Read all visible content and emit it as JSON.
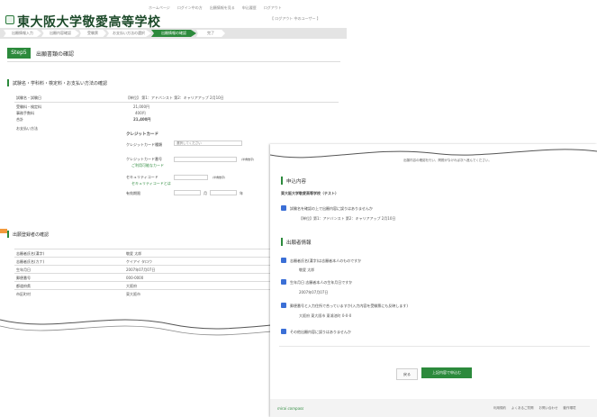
{
  "back": {
    "school_name": "東大阪大学敬愛高等学校",
    "top_links": [
      "ホームページ",
      "ログイン中の方",
      "出願情報を見る",
      "申込履歴",
      "ログアウト"
    ],
    "user": "【 ログアウト 中のユーザー 】",
    "steps": [
      "出願情報入力",
      "出願内容確認",
      "受験票",
      "お支払い方法の選択",
      "出願情報の確認",
      "完了"
    ],
    "step_badge": "Step5",
    "page_heading": "出願書類の確認",
    "section1_title": "試験名・学科料・検定料・お支払い方法の確認",
    "row_header": {
      "label": "試験名・試験日",
      "value": "【単位】 第1：アドバンスト 第2：キャリアアップ 2月10日"
    },
    "fee_rows": [
      {
        "label": "受験料・検定料",
        "value": "21,000円"
      },
      {
        "label": "事務手数料",
        "value": "400円"
      },
      {
        "label": "合計",
        "value": "21,400円"
      }
    ],
    "payment_label": "お支払い方法",
    "card_heading": "クレジットカード",
    "card_fields": [
      {
        "label": "クレジットカード種類",
        "value": "選択してください"
      },
      {
        "label": "クレジットカード番号",
        "value": ""
      },
      {
        "label": "セキュリティコード",
        "value": ""
      },
      {
        "label": "有効期限",
        "value": ""
      }
    ],
    "card_links": [
      "ご利用可能なカード",
      "セキュリティコードとは"
    ],
    "card_notes": [
      "(半角数字)",
      "(半角数字)"
    ],
    "expiry_units": [
      "月",
      "年"
    ],
    "section2_title": "出願登録者の確認",
    "applicant_rows": [
      {
        "label": "志願者氏名(漢字)",
        "value": "敬愛 太郎"
      },
      {
        "label": "志願者氏名(カナ)",
        "value": "ケイアイ タロウ"
      },
      {
        "label": "生年月日",
        "value": "2007年07月07日"
      },
      {
        "label": "郵便番号",
        "value": "000-0000"
      },
      {
        "label": "都道府県",
        "value": "大阪府"
      },
      {
        "label": "市区町村",
        "value": "東大阪市"
      }
    ]
  },
  "front": {
    "top_notice": "出願内容の確認を行い、問題がなければ次へ進んでください。",
    "sec1_title": "申込内容",
    "school_line": "東大阪大学敬愛高等学校（テスト）",
    "check1": "試験名を確認の上で出願内容に誤りはありませんか",
    "check1_detail": "【単位】第1：アドバンスト 第2：キャリアアップ 2月10日",
    "sec2_title": "出願者情報",
    "checks": [
      {
        "label": "志願者氏名(漢字)は志願者本人のものですか",
        "detail": "敬愛 太郎"
      },
      {
        "label": "生年月日 志願者本人の生年月日ですか",
        "detail": "2007年07月07日"
      },
      {
        "label": "郵便番号と入力住所で合っていますか(入力内容を受験票にも反映します)",
        "detail": "大阪府 東大阪市 東鴻池町 0-0-0"
      },
      {
        "label": "その他出願内容に誤りはありませんか",
        "detail": ""
      }
    ],
    "btn_back": "戻る",
    "btn_next": "上記内容で申込む",
    "footer_brand": "mirai compass",
    "footer_links": [
      "利用規約",
      "よくあるご質問",
      "お問い合わせ",
      "動作環境"
    ]
  },
  "accent_color": "#2c8a3c",
  "check_color": "#3b6fd6"
}
